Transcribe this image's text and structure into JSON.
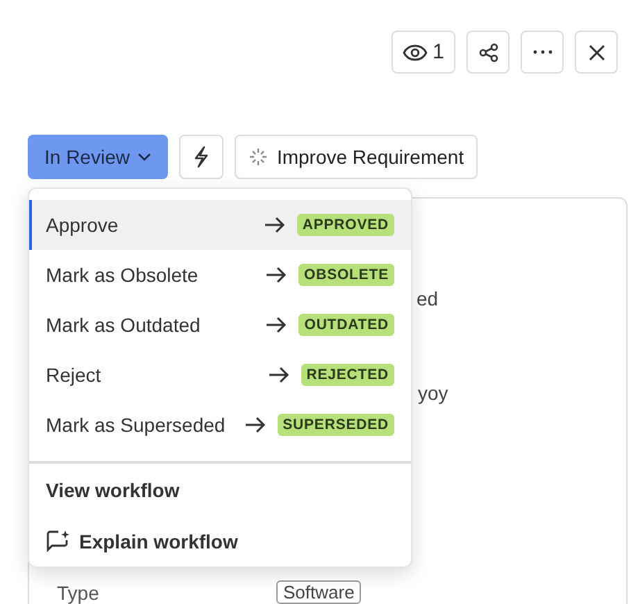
{
  "header": {
    "views": "1"
  },
  "toolbar": {
    "status": "In Review",
    "improve": "Improve Requirement"
  },
  "menu": {
    "transitions": [
      {
        "label": "Approve",
        "target": "APPROVED",
        "selected": true
      },
      {
        "label": "Mark as Obsolete",
        "target": "OBSOLETE",
        "selected": false
      },
      {
        "label": "Mark as Outdated",
        "target": "OUTDATED",
        "selected": false
      },
      {
        "label": "Reject",
        "target": "REJECTED",
        "selected": false
      },
      {
        "label": "Mark as Superseded",
        "target": "SUPERSEDED",
        "selected": false
      }
    ],
    "actions": [
      {
        "label": "View workflow",
        "kind": "plain"
      },
      {
        "label": "Explain workflow",
        "kind": "ai"
      }
    ]
  },
  "card": {
    "fragments": [
      "ed",
      "yoy"
    ],
    "type_label": "Type",
    "type_value": "Software"
  }
}
